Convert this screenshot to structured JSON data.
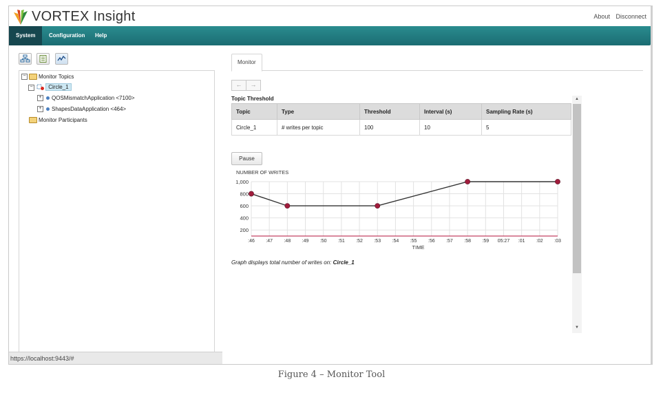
{
  "header": {
    "brand": "VORTEX Insight",
    "links": [
      "About",
      "Disconnect"
    ]
  },
  "nav": {
    "items": [
      {
        "label": "System",
        "active": true
      },
      {
        "label": "Configuration",
        "active": false
      },
      {
        "label": "Help",
        "active": false
      }
    ]
  },
  "toolbar": {
    "icons": [
      "topology-icon",
      "list-icon",
      "monitor-chart-icon"
    ]
  },
  "tree": {
    "root_topics": "Monitor Topics",
    "topic": "Circle_1",
    "apps": [
      "QOSMismatchApplication <7100>",
      "ShapesDataApplication <464>"
    ],
    "root_participants": "Monitor Participants"
  },
  "status_url": "https://localhost:9443/#",
  "tab": "Monitor",
  "nav_arrows": {
    "back": "←",
    "forward": "→"
  },
  "threshold": {
    "title": "Topic Threshold",
    "headers": [
      "Topic",
      "Type",
      "Threshold",
      "Interval (s)",
      "Sampling Rate (s)"
    ],
    "row": [
      "Circle_1",
      "# writes per topic",
      "100",
      "10",
      "5"
    ]
  },
  "pause_label": "Pause",
  "chart_data": {
    "type": "line",
    "ylabel": "NUMBER OF WRITES",
    "xlabel": "TIME",
    "yticks": [
      "1,000",
      "800",
      "600",
      "400",
      "200"
    ],
    "ylim": [
      100,
      1000
    ],
    "x": [
      ":46",
      ":47",
      ":48",
      ":49",
      ":50",
      ":51",
      ":52",
      ":53",
      ":54",
      ":55",
      ":56",
      ":57",
      ":58",
      ":59",
      "05:27",
      ":01",
      ":02",
      ":03"
    ],
    "series": [
      {
        "points": [
          {
            "x": ":46",
            "y": 800
          },
          {
            "x": ":48",
            "y": 600
          },
          {
            "x": ":53",
            "y": 600
          },
          {
            "x": ":58",
            "y": 1000
          },
          {
            "x": ":03",
            "y": 1000
          }
        ]
      }
    ],
    "threshold_line": 100,
    "grid": true,
    "line_color": "#333333",
    "marker_color": "#a01c3c",
    "threshold_color": "#b3123b"
  },
  "caption_prefix": "Graph displays total number of writes on: ",
  "caption_topic": "Circle_1",
  "figure_caption": "Figure 4 – Monitor Tool"
}
